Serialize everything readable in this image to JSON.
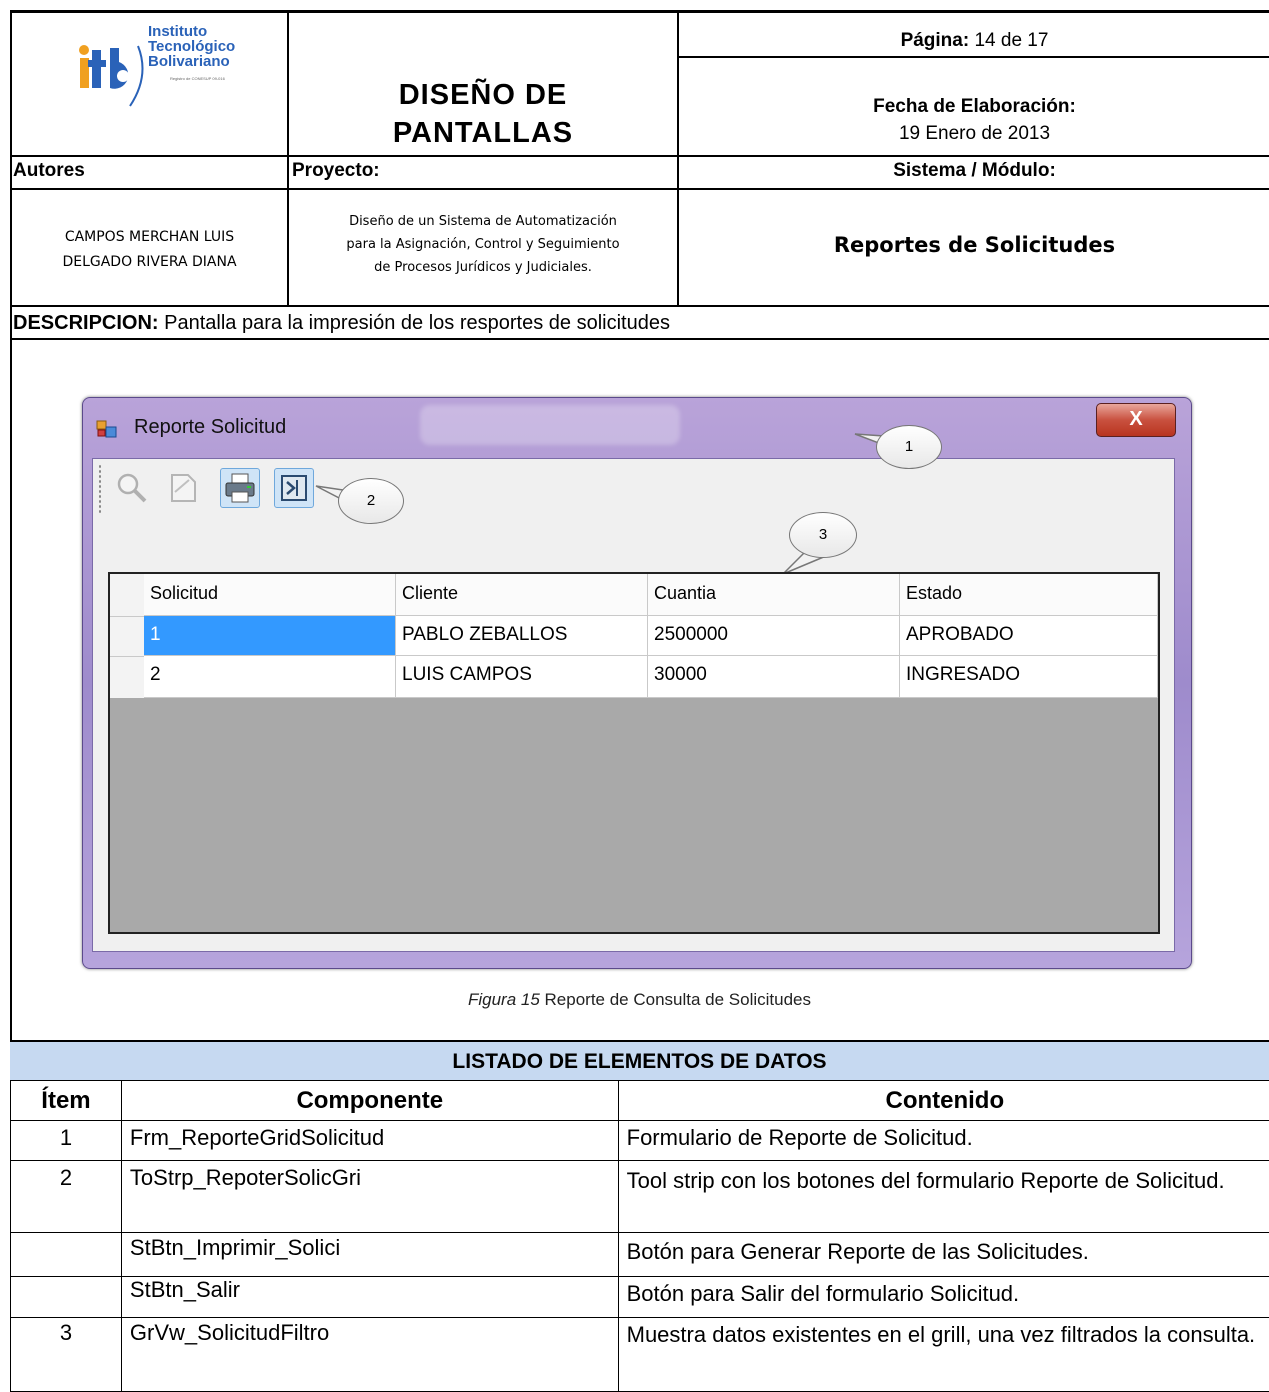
{
  "header": {
    "logo_text": "itb",
    "logo_name_1": "Instituto",
    "logo_name_2": "Tecnológico",
    "logo_name_3": "Bolivariano",
    "logo_sub": "Registro de CONESUP 09-016",
    "title_line1": "DISEÑO DE",
    "title_line2": "PANTALLAS",
    "page_label": "Página:",
    "page_value": "14 de 17",
    "date_label": "Fecha de Elaboración:",
    "date_value": "19 Enero de 2013",
    "authors_label": "Autores",
    "project_label": "Proyecto:",
    "system_label": "Sistema / Módulo:",
    "authors_1": "CAMPOS MERCHAN LUIS",
    "authors_2": "DELGADO RIVERA DIANA",
    "project_1": "Diseño de un Sistema de Automatización",
    "project_2": "para la Asignación, Control y Seguimiento",
    "project_3": "de Procesos Jurídicos y Judiciales.",
    "module": "Reportes de Solicitudes",
    "description_label": "DESCRIPCION:",
    "description_text": " Pantalla para la impresión de los resportes de solicitudes"
  },
  "window": {
    "title": "Reporte Solicitud",
    "close": "X",
    "callouts": [
      "1",
      "2",
      "3"
    ],
    "toolbar_icons": [
      "search-icon",
      "document-icon",
      "print-icon",
      "exit-icon"
    ],
    "columns": [
      "Solicitud",
      "Cliente",
      "Cuantia",
      "Estado"
    ],
    "rows": [
      [
        "1",
        "PABLO ZEBALLOS",
        "2500000",
        "APROBADO"
      ],
      [
        "2",
        "LUIS CAMPOS",
        "30000",
        "INGRESADO"
      ]
    ]
  },
  "caption": {
    "fig": "Figura 15",
    "text": " Reporte de Consulta de Solicitudes"
  },
  "listing": {
    "title": "LISTADO DE ELEMENTOS DE DATOS",
    "headers": [
      "Ítem",
      "Componente",
      "Contenido"
    ],
    "rows": [
      {
        "item": "1",
        "component": "Frm_ReporteGridSolicitud",
        "content": "Formulario de Reporte de Solicitud."
      },
      {
        "item": "2",
        "component": "ToStrp_RepoterSolicGri",
        "content": "Tool strip con los botones del formulario Reporte de Solicitud."
      },
      {
        "item": "",
        "component": "StBtn_Imprimir_Solici",
        "content": "Botón para Generar Reporte de las Solicitudes."
      },
      {
        "item": "",
        "component": "StBtn_Salir",
        "content": "Botón para Salir del formulario Solicitud."
      },
      {
        "item": "3",
        "component": "GrVw_SolicitudFiltro",
        "content": "Muestra datos existentes en el grill,  una vez filtrados la consulta."
      }
    ]
  }
}
